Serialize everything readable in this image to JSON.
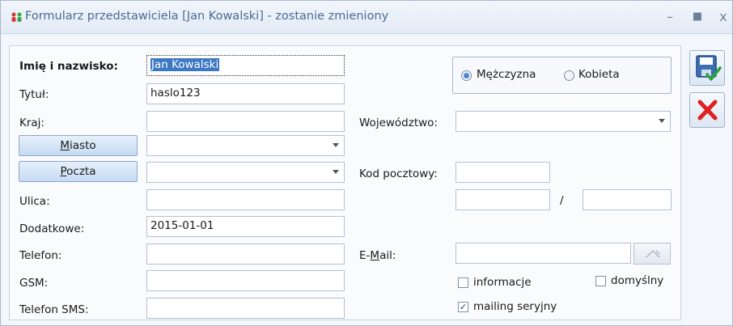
{
  "window": {
    "title": "Formularz przedstawiciela [Jan Kowalski] - zostanie zmieniony",
    "minimize": "–",
    "maximize": "■",
    "close": "x"
  },
  "form": {
    "name_label": "Imię i nazwisko:",
    "name_value": "Jan Kowalski",
    "title_label": "Tytuł:",
    "title_value": "haslo123",
    "country_label": "Kraj:",
    "country_value": "",
    "city_button": "Miasto",
    "city_value": "",
    "post_button": "Poczta",
    "post_value": "",
    "street_label": "Ulica:",
    "street_value": "",
    "extra_label": "Dodatkowe:",
    "extra_value": "2015-01-01",
    "phone_label": "Telefon:",
    "phone_value": "",
    "gsm_label": "GSM:",
    "gsm_value": "",
    "sms_label": "Telefon SMS:",
    "sms_value": "",
    "gender_male": "Mężczyzna",
    "gender_female": "Kobieta",
    "gender_selected": "Mężczyzna",
    "region_label": "Województwo:",
    "region_value": "",
    "postcode_label": "Kod pocztowy:",
    "postcode_value": "",
    "house_no": "",
    "flat_separator": "/",
    "flat_no": "",
    "email_label": "E-Mail:",
    "email_value": "",
    "check_info": "informacje",
    "check_info_checked": false,
    "check_default": "domyślny",
    "check_default_checked": false,
    "check_mailing": "mailing seryjny",
    "check_mailing_checked": true
  },
  "colors": {
    "accent": "#4d87d1",
    "title_text": "#4b6b94",
    "delete_red": "#e02020"
  },
  "icons": {
    "save": "save-icon",
    "cancel": "delete-icon",
    "email_action": "envelope-icon",
    "app": "people-icon"
  }
}
